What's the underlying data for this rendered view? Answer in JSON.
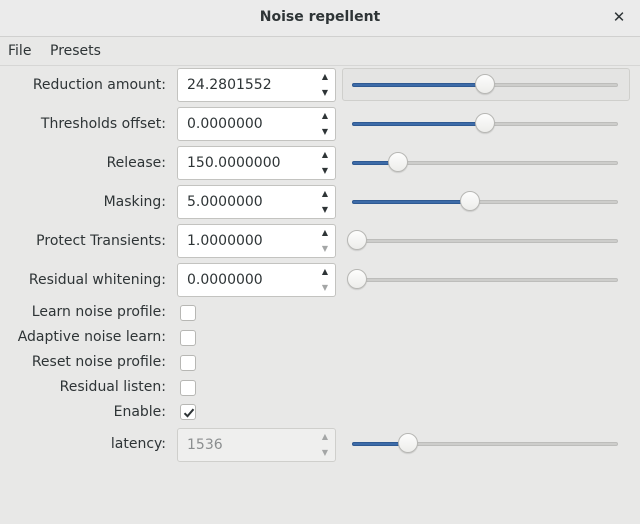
{
  "window": {
    "title": "Noise repellent",
    "close_icon": "close-icon"
  },
  "menu": {
    "items": [
      "File",
      "Presets"
    ]
  },
  "controls": [
    {
      "label": "Reduction amount:",
      "value": "24.2801552",
      "slider_level": 0.5,
      "up_enabled": true,
      "down_enabled": true,
      "disabled": false
    },
    {
      "label": "Thresholds offset:",
      "value": "0.0000000",
      "slider_level": 0.5,
      "up_enabled": true,
      "down_enabled": true,
      "disabled": false
    },
    {
      "label": "Release:",
      "value": "150.0000000",
      "slider_level": 0.16,
      "up_enabled": true,
      "down_enabled": true,
      "disabled": false
    },
    {
      "label": "Masking:",
      "value": "5.0000000",
      "slider_level": 0.44,
      "up_enabled": true,
      "down_enabled": true,
      "disabled": false
    },
    {
      "label": "Protect Transients:",
      "value": "1.0000000",
      "slider_level": 0.0,
      "up_enabled": true,
      "down_enabled": false,
      "disabled": false
    },
    {
      "label": "Residual whitening:",
      "value": "0.0000000",
      "slider_level": 0.0,
      "up_enabled": true,
      "down_enabled": false,
      "disabled": false
    }
  ],
  "toggles": [
    {
      "label": "Learn noise profile:",
      "checked": false
    },
    {
      "label": "Adaptive noise learn:",
      "checked": false
    },
    {
      "label": "Reset noise profile:",
      "checked": false
    },
    {
      "label": "Residual listen:",
      "checked": false
    },
    {
      "label": "Enable:",
      "checked": true
    }
  ],
  "latency": {
    "label": "latency:",
    "value": "1536",
    "slider_level": 0.2,
    "disabled": true
  },
  "colors": {
    "accent": "#3d6ba8",
    "background": "#e8e8e7",
    "text": "#2e3436"
  }
}
